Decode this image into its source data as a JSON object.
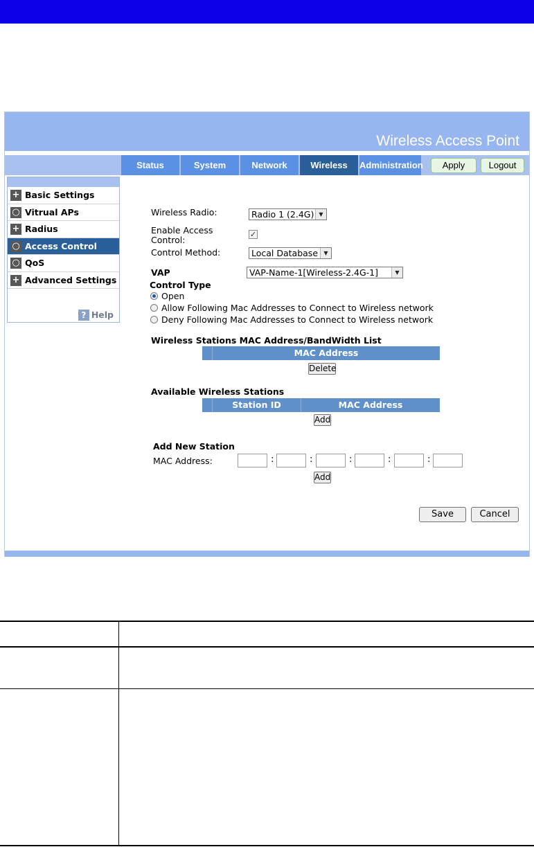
{
  "banner": {
    "title": "Wireless Access Point"
  },
  "tabs": [
    {
      "label": "Status"
    },
    {
      "label": "System"
    },
    {
      "label": "Network"
    },
    {
      "label": "Wireless"
    },
    {
      "label": "Administration"
    }
  ],
  "header_buttons": {
    "apply": "Apply",
    "logout": "Logout"
  },
  "sidebar": {
    "items": [
      {
        "label": "Basic Settings",
        "icon": "plus-icon"
      },
      {
        "label": "Vitrual APs",
        "icon": "circle-icon"
      },
      {
        "label": "Radius",
        "icon": "plus-icon"
      },
      {
        "label": "Access Control",
        "icon": "circle-icon"
      },
      {
        "label": "QoS",
        "icon": "circle-icon"
      },
      {
        "label": "Advanced Settings",
        "icon": "plus-icon"
      }
    ],
    "help_label": "Help"
  },
  "form": {
    "wireless_radio_label": "Wireless Radio:",
    "wireless_radio_value": "Radio 1 (2.4G)",
    "enable_access_line1": "Enable Access",
    "enable_access_line2": "Control:",
    "enable_access_checked": true,
    "control_method_label": "Control Method:",
    "control_method_value": "Local Database",
    "vap_label": "VAP",
    "vap_value": "VAP-Name-1[Wireless-2.4G-1]",
    "control_type_label": "Control Type",
    "control_type_options": [
      "Open",
      "Allow Following Mac Addresses to Connect to Wireless network",
      "Deny Following Mac Addresses to Connect to Wireless network"
    ],
    "control_type_selected": "Open"
  },
  "mac_list": {
    "title": "Wireless Stations MAC Address/BandWidth List",
    "column": "MAC Address",
    "delete_label": "Delete"
  },
  "available": {
    "title": "Available Wireless Stations",
    "columns": [
      "Station ID",
      "MAC Address"
    ],
    "add_label": "Add"
  },
  "new_station": {
    "title": "Add New Station",
    "mac_label": "MAC Address:",
    "separator": ":",
    "add_label": "Add"
  },
  "actions": {
    "save": "Save",
    "cancel": "Cancel"
  }
}
